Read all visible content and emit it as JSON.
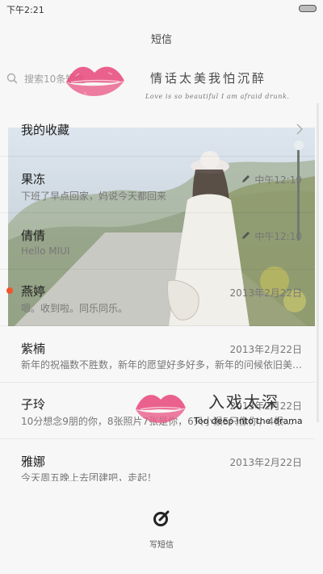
{
  "status_bar": {
    "time": "下午2:21"
  },
  "app": {
    "title": "短信"
  },
  "search": {
    "placeholder": "搜索10条短信"
  },
  "decor": {
    "tagline_cn": "情话太美我怕沉醉",
    "tagline_en": "Love is so beautiful I am afraid drunk.",
    "drama_cn": "入戏太深",
    "drama_en": "Too deep into the drama"
  },
  "favorites": {
    "label": "我的收藏"
  },
  "messages": [
    {
      "name": "果冻",
      "preview": "下班了早点回家，妈说今天都回来",
      "date": "中午12:19",
      "draft": true,
      "unread": false
    },
    {
      "name": "倩倩",
      "preview": "Hello MIUI",
      "date": "中午12:10",
      "draft": true,
      "unread": false
    },
    {
      "name": "燕婷",
      "preview": "嗯。收到啦。同乐同乐。",
      "date": "2013年2月22日",
      "draft": false,
      "unread": true
    },
    {
      "name": "紫楠",
      "preview": "新年的祝福数不胜数，新年的愿望好多好多，新年的问候依旧美…",
      "date": "2013年2月22日",
      "draft": false,
      "unread": false
    },
    {
      "name": "子玲",
      "preview": "10分想念9朋的你，8张照片7张是你，6只小猴5只像你，4根骨…",
      "date": "2013年2月22日",
      "draft": false,
      "unread": false
    },
    {
      "name": "雅娜",
      "preview": "今天周五晚上去团建吧，走起！",
      "date": "2013年2月22日",
      "draft": false,
      "unread": false
    }
  ],
  "bottom": {
    "compose_label": "写短信"
  },
  "colors": {
    "unread": "#f2552c",
    "lips": "#e8477a"
  }
}
